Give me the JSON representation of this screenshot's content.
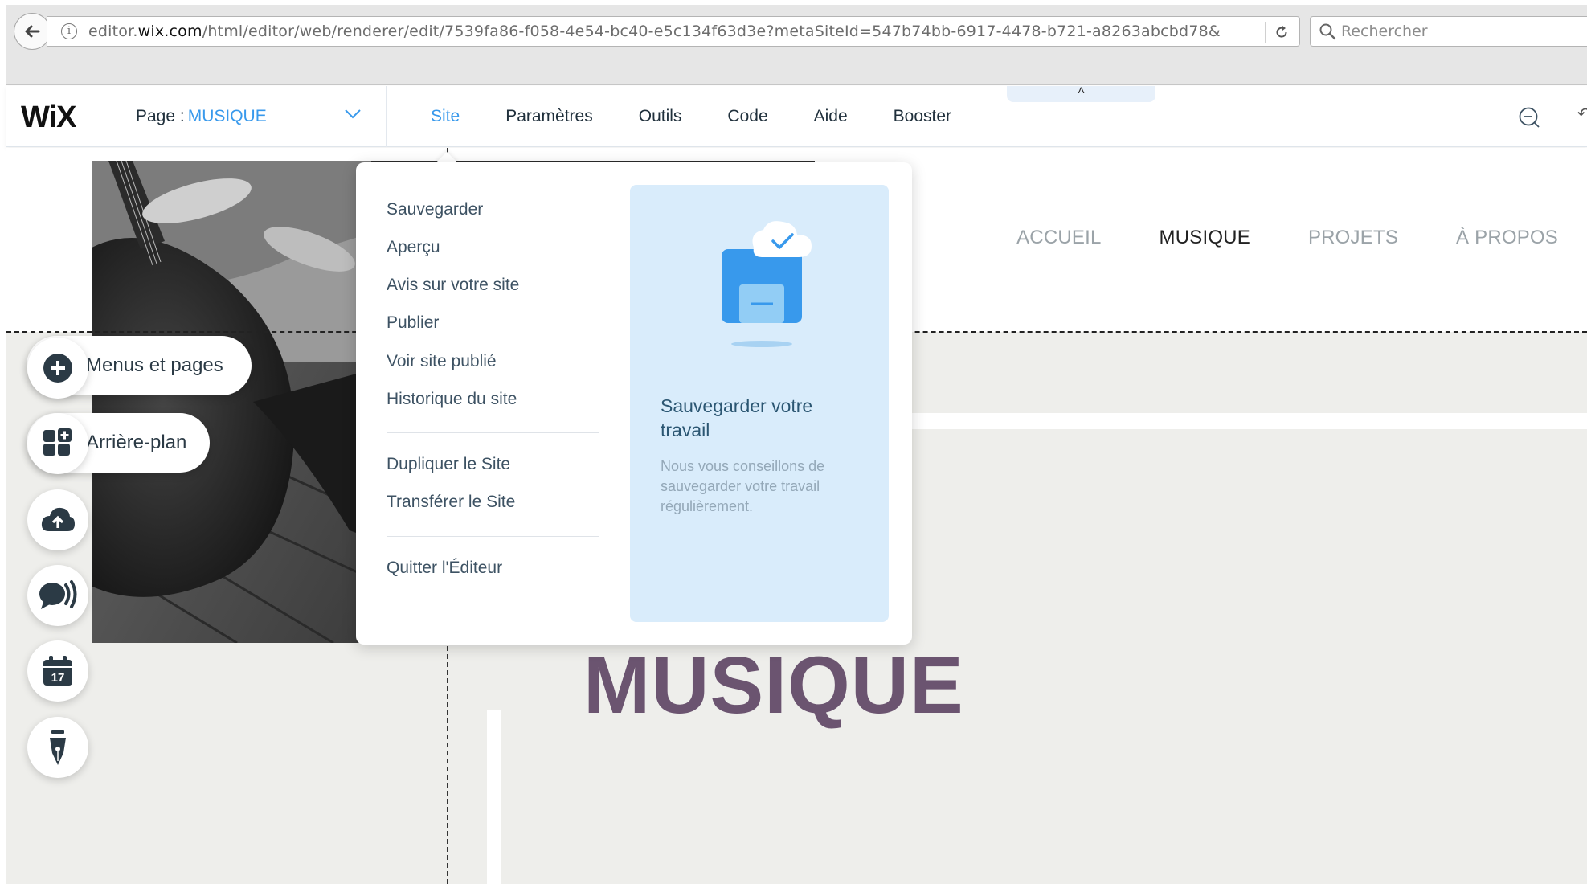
{
  "browser": {
    "url_prefix": "editor.",
    "url_domain": "wix.com",
    "url_rest": "/html/editor/web/renderer/edit/7539fa86-f058-4e54-bc40-e5c134f63d3e?metaSiteId=547b74bb-6917-4478-b721-a8263abcbd78&",
    "search_placeholder": "Rechercher"
  },
  "topbar": {
    "logo": "WiX",
    "page_prefix": "Page :",
    "page_name": "MUSIQUE",
    "nav": [
      {
        "label": "Site",
        "active": true
      },
      {
        "label": "Paramètres"
      },
      {
        "label": "Outils"
      },
      {
        "label": "Code"
      },
      {
        "label": "Aide"
      },
      {
        "label": "Booster"
      }
    ],
    "collapse_glyph": "˄"
  },
  "left_panel": {
    "menus_label": "Menus et pages",
    "background_label": "Arrière-plan",
    "buttons": [
      "add-icon",
      "app-market-icon",
      "upload-icon",
      "chat-icon",
      "calendar-icon",
      "pen-icon"
    ],
    "calendar_day": "17"
  },
  "site_menu": {
    "items": [
      "Sauvegarder",
      "Aperçu",
      "Avis sur votre site",
      "Publier",
      "Voir site publié",
      "Historique du site",
      "Dupliquer le Site",
      "Transférer le Site",
      "Quitter l'Éditeur"
    ],
    "card_title": "Sauvegarder votre travail",
    "card_desc": "Nous vous conseillons de sauvegarder votre travail régulièrement."
  },
  "site": {
    "nav": [
      "ACCUEIL",
      "MUSIQUE",
      "PROJETS",
      "À PROPOS"
    ],
    "current": "MUSIQUE",
    "title": "MUSIQUE"
  },
  "colors": {
    "accent": "#3899ec",
    "title": "#6b5470",
    "card_bg": "#d9ecfb"
  }
}
